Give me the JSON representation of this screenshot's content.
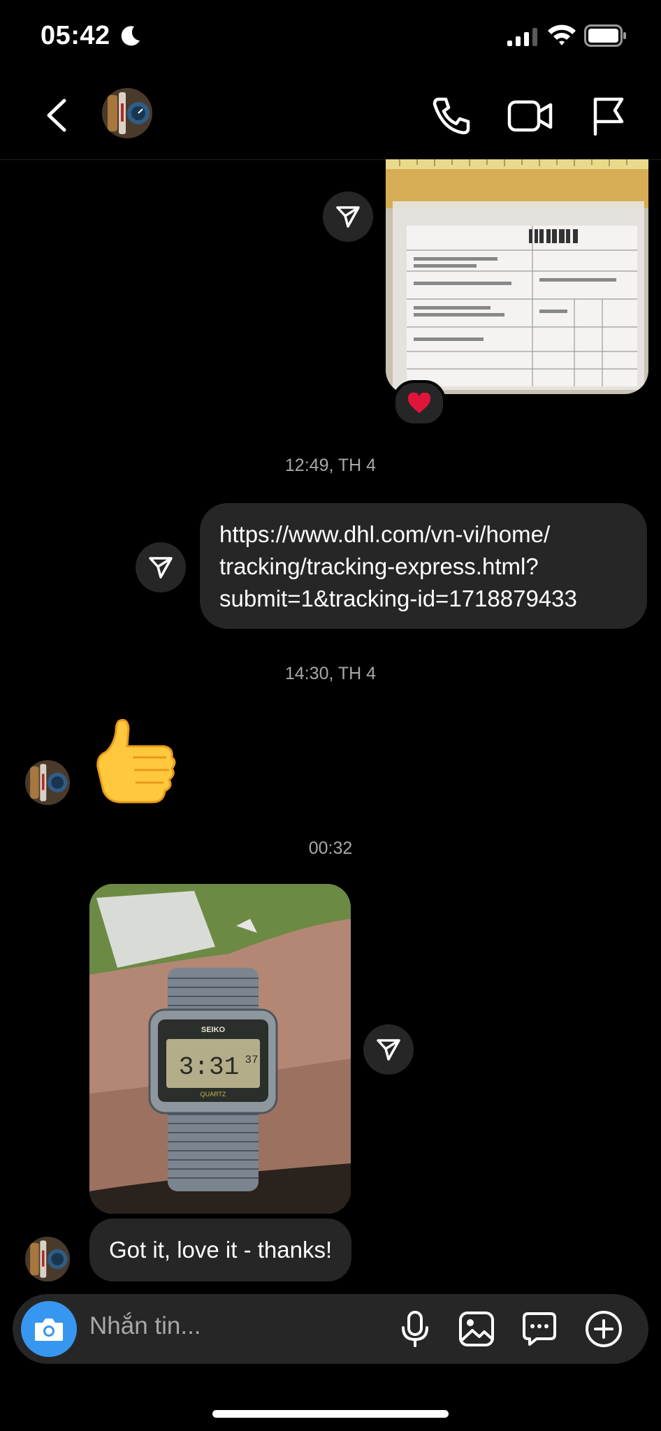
{
  "status_bar": {
    "time": "05:42"
  },
  "header": {
    "contact_name": ""
  },
  "messages": {
    "timestamp_1": "12:49, TH 4",
    "link_lines": [
      "https://www.dhl.com/vn-vi/home/",
      "tracking/tracking-express.html?",
      "submit=1&tracking-id=1718879433"
    ],
    "timestamp_2": "14:30, TH 4",
    "timestamp_3": "00:32",
    "reply_text": "Got it, love it - thanks!",
    "reaction": "❤️",
    "thumbs_up": "👍"
  },
  "composer": {
    "placeholder": "Nhắn tin..."
  },
  "colors": {
    "accent": "#3797f0",
    "bubble": "#262626",
    "background": "#000000",
    "muted": "#a8a8a8"
  },
  "icons": [
    "moon-icon",
    "signal-icon",
    "wifi-icon",
    "battery-icon",
    "back-icon",
    "phone-icon",
    "video-icon",
    "flag-icon",
    "share-icon",
    "heart-icon",
    "camera-icon",
    "microphone-icon",
    "gallery-icon",
    "sticker-icon",
    "plus-icon"
  ]
}
